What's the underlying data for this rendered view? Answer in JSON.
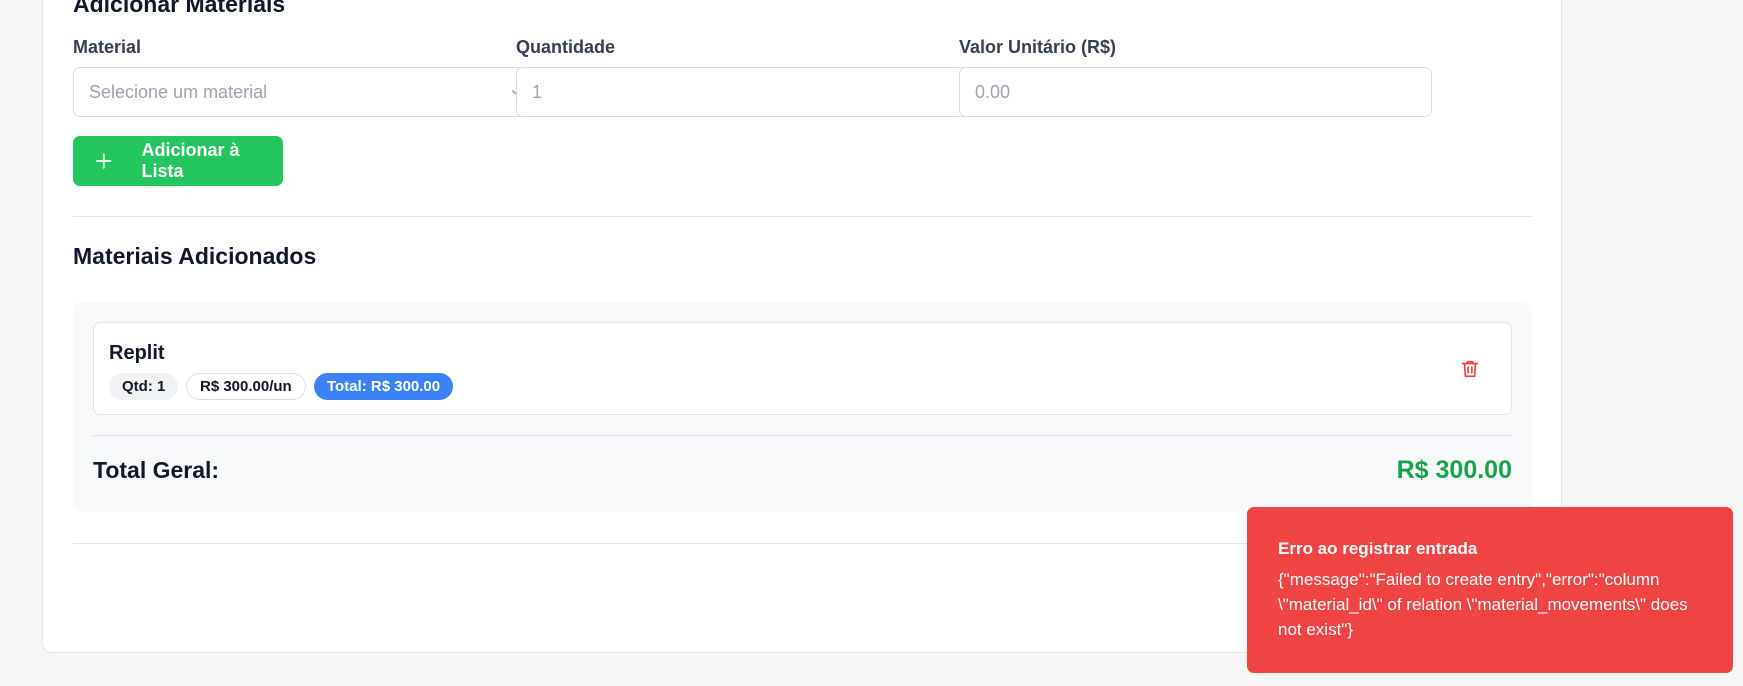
{
  "form": {
    "section_title": "Adicionar Materiais",
    "material_label": "Material",
    "material_placeholder": "Selecione um material",
    "quantity_label": "Quantidade",
    "quantity_value": "1",
    "unit_value_label": "Valor Unitário (R$)",
    "unit_value_placeholder": "0.00",
    "add_button_label": "Adicionar à Lista"
  },
  "list": {
    "section_title": "Materiais Adicionados",
    "items": [
      {
        "name": "Replit",
        "qty_badge": "Qtd: 1",
        "price_badge": "R$ 300.00/un",
        "total_badge": "Total: R$ 300.00"
      }
    ],
    "grand_total_label": "Total Geral:",
    "grand_total_value": "R$ 300.00"
  },
  "toast": {
    "title": "Erro ao registrar entrada",
    "message": "{\"message\":\"Failed to create entry\",\"error\":\"column \\\"material_id\\\" of relation \\\"material_movements\\\" does not exist\"}"
  },
  "icons": {
    "select": "chevron-down-icon",
    "add": "plus-icon",
    "delete": "trash-icon"
  },
  "colors": {
    "add_button": "#22c55e",
    "total_badge": "#3b82f6",
    "grand_total": "#16a34a",
    "delete_icon": "#ef4444",
    "toast_bg": "#ef4444"
  }
}
